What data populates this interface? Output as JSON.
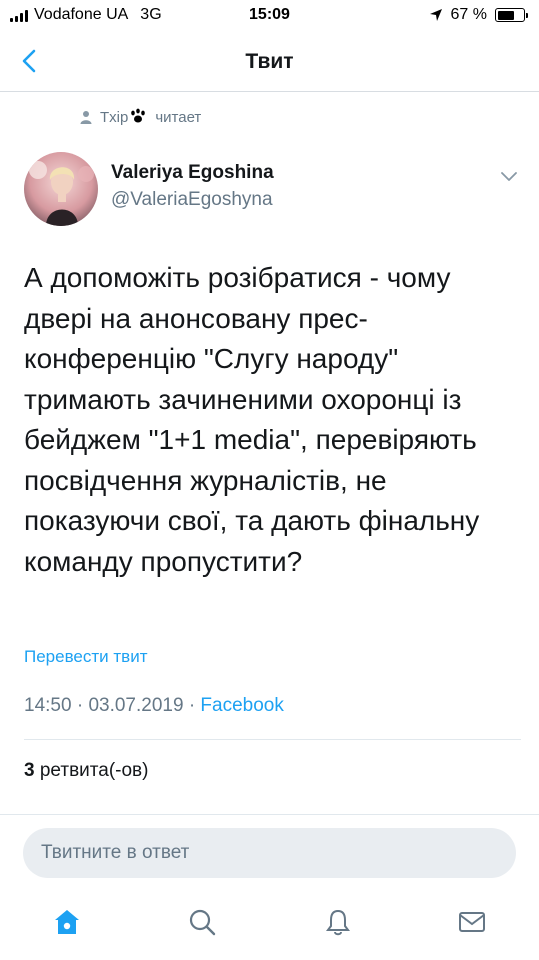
{
  "status_bar": {
    "carrier": "Vodafone UA",
    "network": "3G",
    "time": "15:09",
    "battery": "67 %",
    "battery_level": 0.67
  },
  "nav": {
    "title": "Твит"
  },
  "context": {
    "user": "Txip",
    "action": "читает"
  },
  "author": {
    "name": "Valeriya Egoshina",
    "handle": "@ValeriaEgoshyna"
  },
  "tweet": {
    "text": "А допоможіть розібратися - чому двері на анонсовану прес-конференцію \"Слугу народу\" тримають зачиненими охоронці із бейджем \"1+1 media\", перевіряють посвідчення журналістів, не показуючи свої, та дають фінальну команду пропустити?",
    "translate": "Перевести твит",
    "time": "14:50",
    "date": "03.07.2019",
    "source": "Facebook",
    "retweet_count": "3",
    "retweet_label": "ретвита(-ов)"
  },
  "reply": {
    "placeholder": "Твитните в ответ"
  },
  "tabs": [
    "home-icon",
    "search-icon",
    "notifications-icon",
    "messages-icon"
  ],
  "colors": {
    "accent": "#1da1f2",
    "secondary_text": "#657786",
    "divider": "#e1e8ed"
  }
}
